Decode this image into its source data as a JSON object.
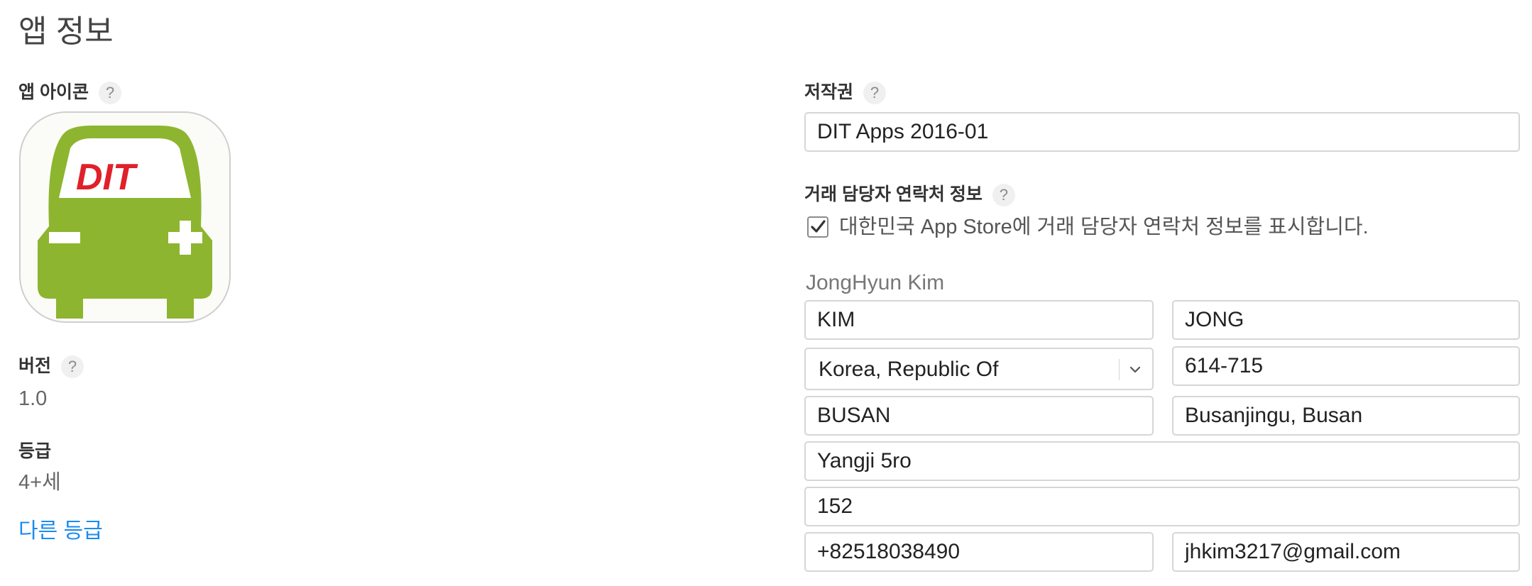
{
  "page": {
    "title": "앱 정보"
  },
  "left": {
    "app_icon": {
      "label": "앱 아이콘",
      "help": "?",
      "logo_text": "DIT",
      "colors": {
        "body": "#8db52f",
        "window": "#ffffff",
        "logo": "#e0202a",
        "background": "#fbfbf7"
      }
    },
    "version": {
      "label": "버전",
      "help": "?",
      "value": "1.0"
    },
    "rating": {
      "label": "등급",
      "value": "4+세",
      "link": "다른 등급"
    }
  },
  "right": {
    "copyright": {
      "label": "저작권",
      "help": "?",
      "value": "DIT Apps 2016-01"
    },
    "contact": {
      "label": "거래 담당자 연락처 정보",
      "help": "?",
      "checkbox_checked": true,
      "checkbox_text": "대한민국 App Store에 거래 담당자 연락처 정보를 표시합니다.",
      "display_name": "JongHyun Kim",
      "last_name": "KIM",
      "first_name": "JONG",
      "country": "Korea, Republic Of",
      "postal_code": "614-715",
      "city": "BUSAN",
      "region": "Busanjingu, Busan",
      "address_line1": "Yangji 5ro",
      "address_line2": "152",
      "phone": "+82518038490",
      "email": "jhkim3217@gmail.com"
    }
  },
  "theme": {
    "link_color": "#1b8bf0",
    "border_color": "#d6d6d6"
  }
}
